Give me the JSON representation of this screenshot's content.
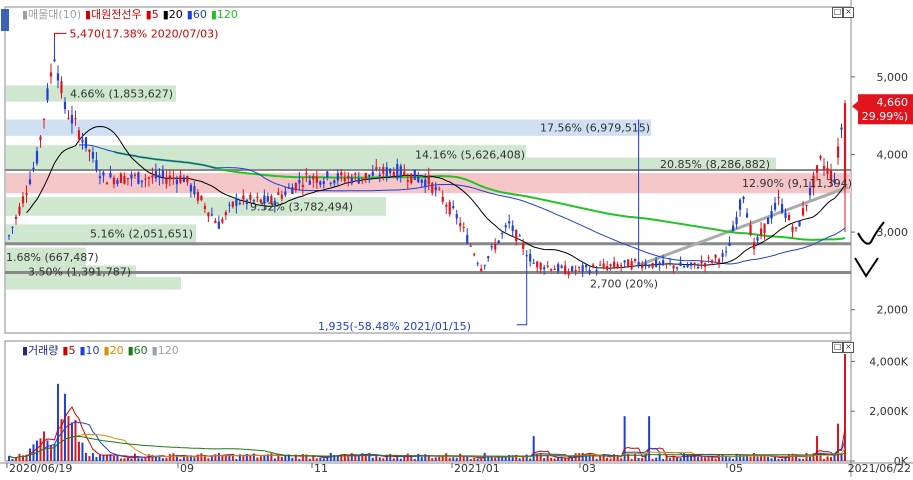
{
  "price_panel": {
    "legend": [
      {
        "label": "매물대(10)",
        "color": "#9aa0a6"
      },
      {
        "label": "대원전선우",
        "color": "#d40000"
      },
      {
        "label": "5",
        "color": "#d40000"
      },
      {
        "label": "20",
        "color": "#000000"
      },
      {
        "label": "60",
        "color": "#1f3fd8"
      },
      {
        "label": "120",
        "color": "#22c422"
      }
    ],
    "max_annotation": "5,470(17.38% 2020/07/03)",
    "min_annotation": "1,935(-58.48% 2021/01/15)",
    "current_price": "4,660",
    "current_change": "( 29.99%)",
    "y_axis_ticks": [
      "5,000",
      "4,000",
      "3,000",
      "2,000"
    ],
    "volume_profile": [
      {
        "label": "4.66% (1,853,627)",
        "color": "#cfe6cf"
      },
      {
        "label": "17.56% (6,979,515)",
        "color": "#cfe0f3"
      },
      {
        "label": "14.16% (5,626,408)",
        "color": "#cfe6cf"
      },
      {
        "label": "20.85% (8,286,882)",
        "color": "#cfe6cf"
      },
      {
        "label": "12.90% (9,111,394)",
        "color": "#f4c6c8"
      },
      {
        "label": "9.52% (3,782,494)",
        "color": "#cfe6cf"
      },
      {
        "label": "5.16% (2,051,651)",
        "color": "#cfe6cf"
      },
      {
        "label": "1.68% (667,487)",
        "color": "#cfe6cf"
      },
      {
        "label": "3.50% (1,391,787)",
        "color": "#cfe6cf"
      },
      {
        "label": "2,700 (20%)",
        "color": "#cfe6cf"
      }
    ]
  },
  "volume_panel": {
    "legend": [
      {
        "label": "거래량",
        "color": "#1a2a8a"
      },
      {
        "label": "5",
        "color": "#d40000"
      },
      {
        "label": "10",
        "color": "#1f3fd8"
      },
      {
        "label": "20",
        "color": "#e08a00"
      },
      {
        "label": "60",
        "color": "#1a7a1a"
      },
      {
        "label": "120",
        "color": "#9aa0a6"
      }
    ],
    "y_axis_ticks": [
      "4,000K",
      "2,000K",
      "0K"
    ]
  },
  "x_axis": {
    "labels": [
      "2020/06/19",
      "09",
      "11",
      "2021/01",
      "03",
      "05",
      "2021/06/22"
    ]
  },
  "chart_data": {
    "type": "candlestick",
    "title": "대원전선우",
    "x_range": [
      "2020/06/19",
      "2021/06/22"
    ],
    "ylim": [
      1700,
      5900
    ],
    "annotated_points": [
      {
        "date": "2020/07/03",
        "value": 5470,
        "label": "max"
      },
      {
        "date": "2021/01/15",
        "value": 1935,
        "label": "min"
      },
      {
        "date": "2021/06/22",
        "value": 4660,
        "label": "last"
      }
    ],
    "horizontal_lines": [
      3800,
      2850,
      2480
    ],
    "volume_ylim_k": [
      0,
      4500
    ],
    "volume_peak_k": 4300
  }
}
